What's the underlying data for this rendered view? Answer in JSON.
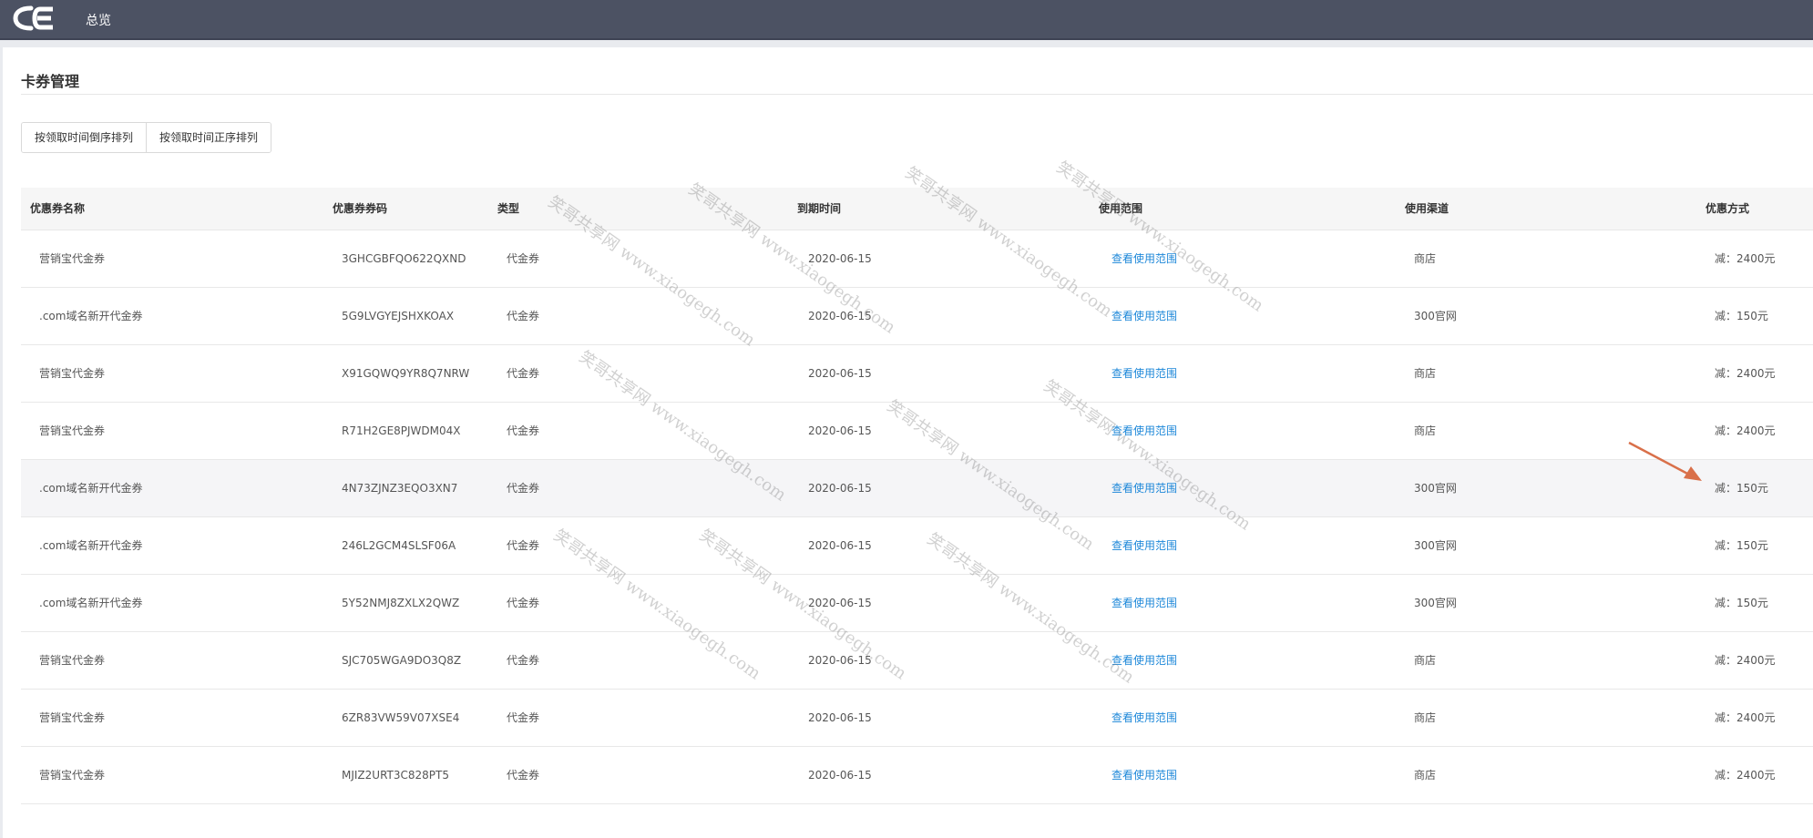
{
  "header": {
    "logo_text": "CE",
    "nav_overview": "总览",
    "bg_color": "#4c5263"
  },
  "page": {
    "title": "卡券管理",
    "sort_buttons": [
      "按领取时间倒序排列",
      "按领取时间正序排列"
    ]
  },
  "table": {
    "columns": [
      "优惠券名称",
      "优惠券券码",
      "类型",
      "到期时间",
      "使用范围",
      "使用渠道",
      "优惠方式"
    ],
    "rows": [
      {
        "name": "营销宝代金券",
        "code": "3GHCGBFQO622QXND",
        "type": "代金券",
        "expiry": "2020-06-15",
        "scope": "查看使用范围",
        "channel": "商店",
        "discount": "减：2400元"
      },
      {
        "name": ".com域名新开代金券",
        "code": "5G9LVGYEJSHXKOAX",
        "type": "代金券",
        "expiry": "2020-06-15",
        "scope": "查看使用范围",
        "channel": "300官网",
        "discount": "减：150元"
      },
      {
        "name": "营销宝代金券",
        "code": "X91GQWQ9YR8Q7NRW",
        "type": "代金券",
        "expiry": "2020-06-15",
        "scope": "查看使用范围",
        "channel": "商店",
        "discount": "减：2400元"
      },
      {
        "name": "营销宝代金券",
        "code": "R71H2GE8PJWDM04X",
        "type": "代金券",
        "expiry": "2020-06-15",
        "scope": "查看使用范围",
        "channel": "商店",
        "discount": "减：2400元"
      },
      {
        "name": ".com域名新开代金券",
        "code": "4N73ZJNZ3EQO3XN7",
        "type": "代金券",
        "expiry": "2020-06-15",
        "scope": "查看使用范围",
        "channel": "300官网",
        "discount": "减：150元"
      },
      {
        "name": ".com域名新开代金券",
        "code": "246L2GCM4SLSF06A",
        "type": "代金券",
        "expiry": "2020-06-15",
        "scope": "查看使用范围",
        "channel": "300官网",
        "discount": "减：150元"
      },
      {
        "name": ".com域名新开代金券",
        "code": "5Y52NMJ8ZXLX2QWZ",
        "type": "代金券",
        "expiry": "2020-06-15",
        "scope": "查看使用范围",
        "channel": "300官网",
        "discount": "减：150元"
      },
      {
        "name": "营销宝代金券",
        "code": "SJC705WGA9DO3Q8Z",
        "type": "代金券",
        "expiry": "2020-06-15",
        "scope": "查看使用范围",
        "channel": "商店",
        "discount": "减：2400元"
      },
      {
        "name": "营销宝代金券",
        "code": "6ZR83VW59V07XSE4",
        "type": "代金券",
        "expiry": "2020-06-15",
        "scope": "查看使用范围",
        "channel": "商店",
        "discount": "减：2400元"
      },
      {
        "name": "营销宝代金券",
        "code": "MJIZ2URT3C828PT5",
        "type": "代金券",
        "expiry": "2020-06-15",
        "scope": "查看使用范围",
        "channel": "商店",
        "discount": "减：2400元"
      }
    ],
    "highlight_row": 4,
    "link_color": "#1e88d9"
  },
  "watermark": {
    "text": "笑哥共享网 www.xiaogegh.com"
  },
  "annotation": {
    "arrow_color": "#d9704a"
  }
}
